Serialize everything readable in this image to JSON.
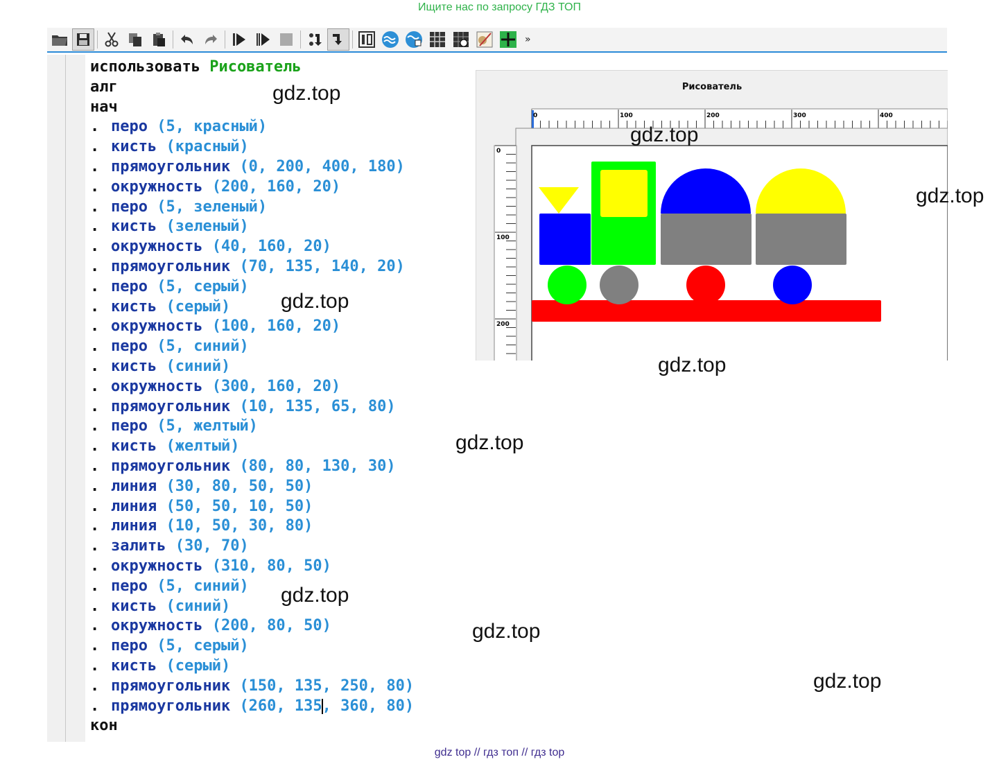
{
  "banner_top": "Ищите нас по запросу ГДЗ ТОП",
  "banner_bottom": "gdz top  //  гдз топ  //  гдз top",
  "toolbar": {
    "icons": [
      "open-folder-icon",
      "save-icon",
      "cut-icon",
      "copy-icon",
      "paste-icon",
      "undo-icon",
      "redo-icon",
      "run-icon",
      "step-run-icon",
      "stop-icon",
      "step-over-icon",
      "step-into-icon",
      "tab-view-icon",
      "robot-icon",
      "turtle-icon",
      "grid-icon",
      "draftsman-icon",
      "drawer-icon",
      "cross-icon"
    ],
    "more_label": "»"
  },
  "code": {
    "line1": {
      "kw": "использовать",
      "module": "Рисователь"
    },
    "line2": "алг",
    "line3": "нач",
    "dot": ".",
    "statements": [
      {
        "cmd": "перо",
        "args": "(5, красный)"
      },
      {
        "cmd": "кисть",
        "args": "(красный)"
      },
      {
        "cmd": "прямоугольник",
        "args": "(0, 200, 400, 180)"
      },
      {
        "cmd": "окружность",
        "args": "(200, 160, 20)"
      },
      {
        "cmd": "перо",
        "args": "(5, зеленый)"
      },
      {
        "cmd": "кисть",
        "args": "(зеленый)"
      },
      {
        "cmd": "окружность",
        "args": "(40, 160, 20)"
      },
      {
        "cmd": "прямоугольник",
        "args": "(70, 135, 140, 20)"
      },
      {
        "cmd": "перо",
        "args": "(5, серый)"
      },
      {
        "cmd": "кисть",
        "args": "(серый)"
      },
      {
        "cmd": "окружность",
        "args": "(100, 160, 20)"
      },
      {
        "cmd": "перо",
        "args": "(5, синий)"
      },
      {
        "cmd": "кисть",
        "args": "(синий)"
      },
      {
        "cmd": "окружность",
        "args": "(300, 160, 20)"
      },
      {
        "cmd": "прямоугольник",
        "args": "(10, 135, 65, 80)"
      },
      {
        "cmd": "перо",
        "args": "(5, желтый)"
      },
      {
        "cmd": "кисть",
        "args": "(желтый)"
      },
      {
        "cmd": "прямоугольник",
        "args": "(80, 80, 130, 30)"
      },
      {
        "cmd": "линия",
        "args": "(30, 80, 50, 50)"
      },
      {
        "cmd": "линия",
        "args": "(50, 50, 10, 50)"
      },
      {
        "cmd": "линия",
        "args": "(10, 50, 30, 80)"
      },
      {
        "cmd": "залить",
        "args": "(30, 70)"
      },
      {
        "cmd": "окружность",
        "args": "(310, 80, 50)"
      },
      {
        "cmd": "перо",
        "args": "(5, синий)"
      },
      {
        "cmd": "кисть",
        "args": "(синий)"
      },
      {
        "cmd": "окружность",
        "args": "(200, 80, 50)"
      },
      {
        "cmd": "перо",
        "args": "(5, серый)"
      },
      {
        "cmd": "кисть",
        "args": "(серый)"
      },
      {
        "cmd": "прямоугольник",
        "args": "(150, 135, 250, 80)"
      }
    ],
    "last_statement": {
      "cmd": "прямоугольник",
      "args_before_caret": "(260, 135",
      "args_after_caret": ", 360, 80)"
    },
    "end_kw": "кон"
  },
  "drawer": {
    "title": "Рисователь",
    "ruler_x": [
      "0",
      "100",
      "200",
      "300",
      "400"
    ],
    "ruler_y": [
      "0",
      "100",
      "200"
    ]
  },
  "watermark": "gdz.top",
  "colors": {
    "keyword": "#111111",
    "module": "#1aa21a",
    "command": "#1a38a0",
    "args": "#2a8fd6",
    "red": "#ff0000",
    "green": "#00ff00",
    "gray": "#808080",
    "blue": "#0000ff",
    "yellow": "#ffff00"
  }
}
